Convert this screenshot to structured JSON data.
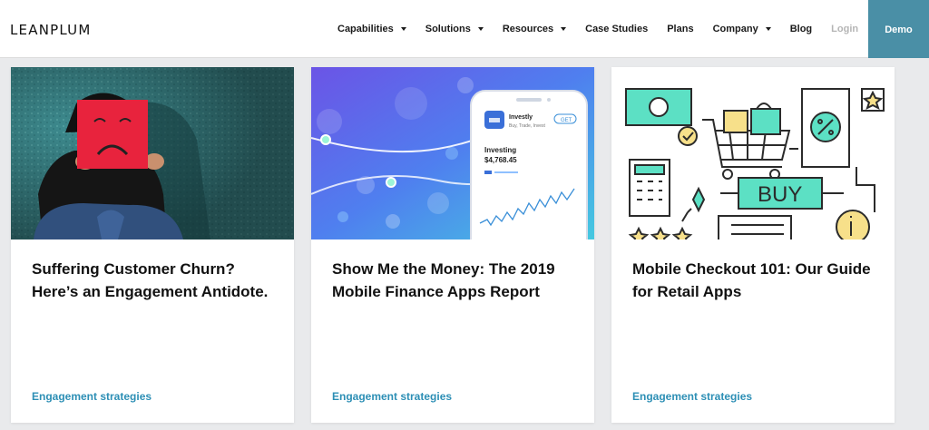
{
  "header": {
    "logo": "LEANPLUM",
    "nav": [
      {
        "label": "Capabilities",
        "dropdown": true
      },
      {
        "label": "Solutions",
        "dropdown": true
      },
      {
        "label": "Resources",
        "dropdown": true
      },
      {
        "label": "Case Studies",
        "dropdown": false
      },
      {
        "label": "Plans",
        "dropdown": false
      },
      {
        "label": "Company",
        "dropdown": true
      },
      {
        "label": "Blog",
        "dropdown": false
      },
      {
        "label": "Login",
        "dropdown": false
      }
    ],
    "demo_label": "Demo"
  },
  "colors": {
    "accent": "#4a8fa6",
    "tag": "#2d8fb5",
    "mint": "#5ce0c4"
  },
  "cards": [
    {
      "title": "Suffering Customer Churn? Here’s an Engagement Antidote.",
      "tag": "Engagement strategies"
    },
    {
      "title": "Show Me the Money: The 2019 Mobile Finance Apps Report",
      "tag": "Engagement strategies",
      "phone": {
        "app_name": "Investly",
        "app_sub": "Buy, Trade, Invest",
        "get_label": "GET",
        "investing_label": "Investing",
        "amount": "$4,768.45"
      }
    },
    {
      "title": "Mobile Checkout 101: Our Guide for Retail Apps",
      "tag": "Engagement strategies",
      "buy_label": "BUY"
    }
  ]
}
